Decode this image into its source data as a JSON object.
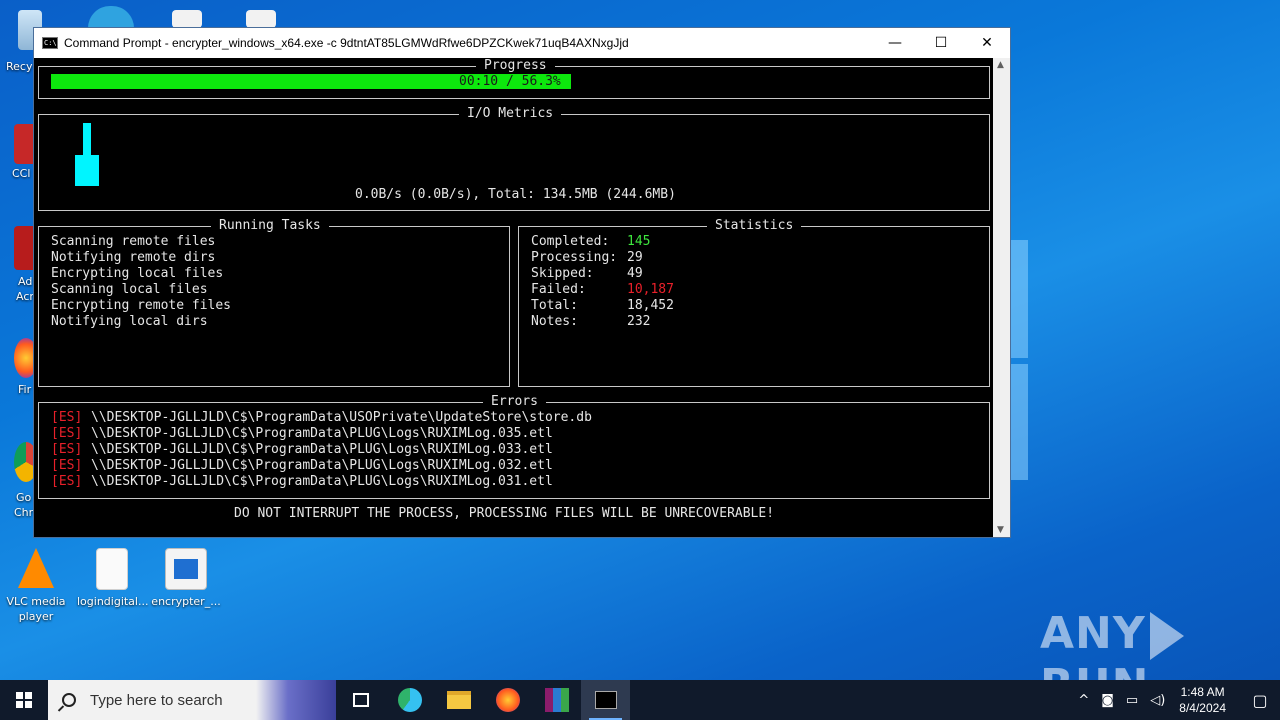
{
  "desktop": {
    "partial_labels": [
      "Recy",
      "CCl",
      "Ad",
      "Acr",
      "Fir",
      "Go",
      "Chr"
    ],
    "icons": [
      {
        "label_lines": [
          "VLC media",
          "player"
        ]
      },
      {
        "label_lines": [
          "logindigital..."
        ]
      },
      {
        "label_lines": [
          "encrypter_..."
        ]
      }
    ],
    "watermark": "ANY RUN"
  },
  "window": {
    "title": "Command Prompt - encrypter_windows_x64.exe  -c 9dtntAT85LGMWdRfwe6DPZCKwek71uqB4AXNxgJjd",
    "minimize": "—",
    "maximize": "☐",
    "close": "✕"
  },
  "console": {
    "progress": {
      "title": "Progress",
      "text": "00:10 / 56.3%",
      "fraction": 0.563
    },
    "io": {
      "title": "I/O Metrics",
      "summary": "0.0B/s (0.0B/s), Total: 134.5MB (244.6MB)"
    },
    "tasks": {
      "title": "Running Tasks",
      "items": [
        "Scanning remote files",
        "Notifying remote dirs",
        "Encrypting local files",
        "Scanning local files",
        "Encrypting remote files",
        "Notifying local dirs"
      ]
    },
    "stats": {
      "title": "Statistics",
      "rows": [
        {
          "label": "Completed: ",
          "value": "145"
        },
        {
          "label": "Processing:",
          "value": "29"
        },
        {
          "label": "Skipped:   ",
          "value": "49"
        },
        {
          "label": "Failed:    ",
          "value": "10,187"
        },
        {
          "label": "Total:     ",
          "value": "18,452"
        },
        {
          "label": "Notes:     ",
          "value": "232"
        }
      ]
    },
    "errors": {
      "title": "Errors",
      "tag": "[ES]",
      "items": [
        "\\\\DESKTOP-JGLLJLD\\C$\\ProgramData\\USOPrivate\\UpdateStore\\store.db",
        "\\\\DESKTOP-JGLLJLD\\C$\\ProgramData\\PLUG\\Logs\\RUXIMLog.035.etl",
        "\\\\DESKTOP-JGLLJLD\\C$\\ProgramData\\PLUG\\Logs\\RUXIMLog.033.etl",
        "\\\\DESKTOP-JGLLJLD\\C$\\ProgramData\\PLUG\\Logs\\RUXIMLog.032.etl",
        "\\\\DESKTOP-JGLLJLD\\C$\\ProgramData\\PLUG\\Logs\\RUXIMLog.031.etl"
      ]
    },
    "warning": "DO NOT INTERRUPT THE PROCESS, PROCESSING FILES WILL BE UNRECOVERABLE!"
  },
  "taskbar": {
    "search_placeholder": "Type here to search",
    "tray": {
      "chevron": "^",
      "time": "1:48 AM",
      "date": "8/4/2024"
    }
  },
  "colors": {
    "accent_green": "#0de80d",
    "cyan": "#00f5ff",
    "error_red": "#e8202a"
  }
}
